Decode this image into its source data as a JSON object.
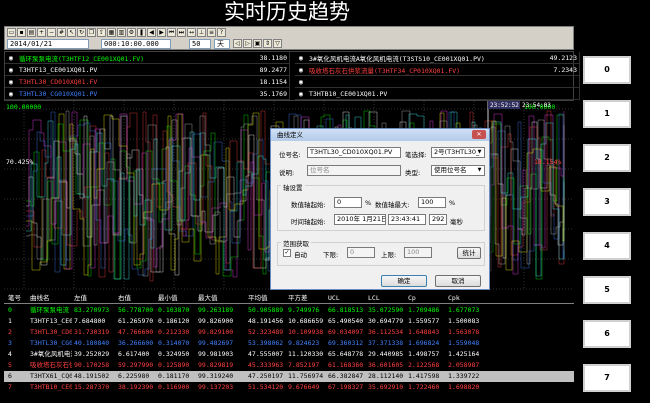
{
  "title": "实时历史趋势",
  "toolbar": {
    "start_time": "2014/01/21 23:44:03.680",
    "duration": "000:10:00.000",
    "zoom": "50",
    "unit": "天"
  },
  "legend": [
    {
      "name": "循环泵泵电流(T3HTF12_CE001XQ01.FV)",
      "value": "38.1180",
      "color": "#00ff00"
    },
    {
      "name": "T3HTF13_CE001XQ01.PV",
      "value": "89.2477",
      "color": "#ffffff"
    },
    {
      "name": "T3HTL30_CD010XQ01.FV",
      "value": "18.1154",
      "color": "#ff4040"
    },
    {
      "name": "T3HTL30_CG010XQ01.PV",
      "value": "35.1769",
      "color": "#4080ff"
    },
    {
      "name": "3#氧化风机电流A氧化风机电流(T3STS10_CE001XQ01.PV)",
      "value": "49.2123",
      "color": "#ffffff"
    },
    {
      "name": "吸收塔石灰石供浆流量(T3HTF34_CP010XQ01.FV)",
      "value": "7.2343",
      "color": "#ff4040"
    },
    {
      "name": "",
      "value": "",
      "color": "#ffffff"
    },
    {
      "name": "T3HTB10_CE001XQ01.PV",
      "value": "",
      "color": "#ffffff"
    }
  ],
  "chart": {
    "y_top": "100.00000",
    "y_mid": "70.425%",
    "y_right_top": "100.0000",
    "y_right_mid": "18.154%",
    "cursor_time": "23:52:52",
    "cursor_time2": "23:54:03"
  },
  "table": {
    "headers": [
      "笔号",
      "曲线名",
      "左值",
      "右值",
      "最小值",
      "最大值",
      "平均值",
      "平方差",
      "UCL",
      "LCL",
      "Cp",
      "Cpk"
    ],
    "rows": [
      {
        "no": "0",
        "name": "循环泵泵电流",
        "l": "83.270973",
        "r": "56.778700",
        "min": "0.103870",
        "max": "99.263189",
        "avg": "50.905889",
        "sq": "9.749976",
        "ucl": "66.818513",
        "lcl": "35.072590",
        "cp": "1.709486",
        "cpk": "1.677073",
        "color": "#00ff00"
      },
      {
        "no": "1",
        "name": "T3HTF13_CE001",
        "l": "7.684800",
        "r": "61.265970",
        "min": "0.186120",
        "max": "99.826900",
        "avg": "48.191456",
        "sq": "10.686659",
        "ucl": "65.490540",
        "lcl": "30.694779",
        "cp": "1.559577",
        "cpk": "1.500083",
        "color": "#ffffff"
      },
      {
        "no": "2",
        "name": "T3HTL30_CD010",
        "l": "31.730319",
        "r": "47.766600",
        "min": "0.212330",
        "max": "99.829100",
        "avg": "52.323489",
        "sq": "10.109938",
        "ucl": "69.034097",
        "lcl": "36.112534",
        "cp": "1.648843",
        "cpk": "1.563078",
        "color": "#ff4040"
      },
      {
        "no": "3",
        "name": "T3HTL30_CG010",
        "l": "40.180840",
        "r": "36.266600",
        "min": "0.314070",
        "max": "99.482697",
        "avg": "53.398062",
        "sq": "9.824623",
        "ucl": "69.360312",
        "lcl": "37.371338",
        "cp": "1.696824",
        "cpk": "1.559048",
        "color": "#4080ff"
      },
      {
        "no": "4",
        "name": "3#氧化风机电流",
        "l": "39.252029",
        "r": "6.617400",
        "min": "0.324950",
        "max": "99.981903",
        "avg": "47.555007",
        "sq": "11.120330",
        "ucl": "65.648778",
        "lcl": "29.440985",
        "cp": "1.498757",
        "cpk": "1.425164",
        "color": "#ffffff"
      },
      {
        "no": "5",
        "name": "吸收塔石灰石供",
        "l": "90.170258",
        "r": "59.297990",
        "min": "0.125890",
        "max": "99.829819",
        "avg": "45.333963",
        "sq": "7.852197",
        "ucl": "61.168360",
        "lcl": "36.601605",
        "cp": "2.122568",
        "cpk": "2.058987",
        "color": "#ff4040"
      },
      {
        "no": "6",
        "name": "T3HTX61_CQ010",
        "l": "48.191502",
        "r": "6.225980",
        "min": "0.181170",
        "max": "99.319240",
        "avg": "47.250197",
        "sq": "11.756974",
        "ucl": "66.382847",
        "lcl": "28.112140",
        "cp": "1.417598",
        "cpk": "1.339722",
        "color": "#ffffff",
        "selected": true
      },
      {
        "no": "7",
        "name": "T3HTB10_CE001",
        "l": "15.287370",
        "r": "38.192390",
        "min": "0.116900",
        "max": "99.137203",
        "avg": "51.534120",
        "sq": "9.676649",
        "ucl": "67.198327",
        "lcl": "35.692910",
        "cp": "1.722460",
        "cpk": "1.698820",
        "color": "#ff4040"
      }
    ]
  },
  "side_buttons": [
    "0",
    "1",
    "2",
    "3",
    "4",
    "5",
    "6",
    "7"
  ],
  "dialog": {
    "title": "曲线定义",
    "tag_label": "位号名:",
    "tag_value": "T3HTL30_CD010XQ01.PV",
    "pen_label": "笔选择:",
    "pen_value": "2号(T3HTL30_",
    "desc_label": "说明:",
    "desc_placeholder": "位号名",
    "type_label": "类型:",
    "type_value": "使用位号名",
    "axis_group": "轴设置",
    "ymin_label": "数值轴起始:",
    "ymin_value": "0",
    "ymin_unit": "%",
    "ymax_label": "数值轴最大:",
    "ymax_value": "100",
    "ymax_unit": "%",
    "t_label": "时间轴起始:",
    "t_date": "2010年 1月21日",
    "t_time": "23:43:41",
    "t_ms": "292",
    "t_ms_unit": "毫秒",
    "range_group": "范围获取",
    "auto_label": "自动",
    "low_label": "下限:",
    "low_value": "0",
    "high_label": "上限:",
    "high_value": "100",
    "stats_label": "统计",
    "ok_label": "确定",
    "cancel_label": "取消"
  }
}
